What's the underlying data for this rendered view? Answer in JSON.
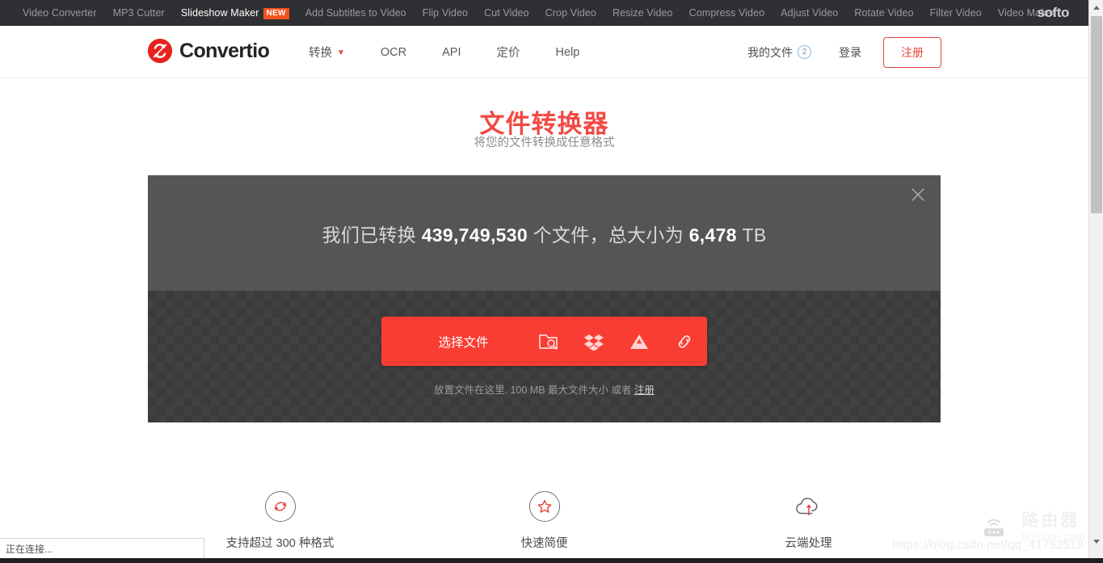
{
  "softo_bar": {
    "links": [
      {
        "label": "Video Converter",
        "active": false,
        "badge": null
      },
      {
        "label": "MP3 Cutter",
        "active": false,
        "badge": null
      },
      {
        "label": "Slideshow Maker",
        "active": true,
        "badge": "NEW"
      },
      {
        "label": "Add Subtitles to Video",
        "active": false,
        "badge": null
      },
      {
        "label": "Flip Video",
        "active": false,
        "badge": null
      },
      {
        "label": "Cut Video",
        "active": false,
        "badge": null
      },
      {
        "label": "Crop Video",
        "active": false,
        "badge": null
      },
      {
        "label": "Resize Video",
        "active": false,
        "badge": null
      },
      {
        "label": "Compress Video",
        "active": false,
        "badge": null
      },
      {
        "label": "Adjust Video",
        "active": false,
        "badge": null
      },
      {
        "label": "Rotate Video",
        "active": false,
        "badge": null
      },
      {
        "label": "Filter Video",
        "active": false,
        "badge": null
      },
      {
        "label": "Video Maker",
        "active": false,
        "badge": null
      }
    ],
    "logo": "softo",
    "bg_color": "#2f3033",
    "badge_color": "#f4511e"
  },
  "header": {
    "brand_name": "Convertio",
    "brand_icon": "convertio-logo-icon",
    "nav": [
      {
        "label": "转换",
        "has_caret": true
      },
      {
        "label": "OCR",
        "has_caret": false
      },
      {
        "label": "API",
        "has_caret": false
      },
      {
        "label": "定价",
        "has_caret": false
      },
      {
        "label": "Help",
        "has_caret": false
      }
    ],
    "my_files_label": "我的文件",
    "my_files_count": "2",
    "login_label": "登录",
    "signup_label": "注册",
    "accent_color": "#e8443c"
  },
  "hero": {
    "title": "文件转换器",
    "subtitle": "将您的文件转换成任意格式",
    "title_color": "#f04a44"
  },
  "stats": {
    "prefix": "我们已转换 ",
    "files_count": "439,749,530",
    "middle": " 个文件，总大小为 ",
    "size_value": "6,478",
    "suffix": " TB",
    "close_icon": "close-icon"
  },
  "dropzone": {
    "choose_label": "选择文件",
    "sources": [
      {
        "name": "folder-search-icon"
      },
      {
        "name": "dropbox-icon"
      },
      {
        "name": "google-drive-icon"
      },
      {
        "name": "link-icon"
      }
    ],
    "hint_before": "放置文件在这里. 100 MB 最大文件大小 或者 ",
    "hint_link": "注册",
    "button_color": "#f93d33"
  },
  "features": [
    {
      "icon": "refresh-cycle-icon",
      "label": "支持超过 300 种格式"
    },
    {
      "icon": "star-icon",
      "label": "快速简便"
    },
    {
      "icon": "cloud-upload-icon",
      "label": "云端处理"
    }
  ],
  "watermark": {
    "icon": "router-icon",
    "cn_text": "路由器",
    "en_text": "luyouqi.com",
    "url_text": "https://blog.csdn.net/qq_41752519"
  },
  "status": {
    "text": "正在连接..."
  },
  "scrollbar": {
    "up_icon": "scroll-up-arrow-icon",
    "down_icon": "scroll-down-arrow-icon"
  }
}
